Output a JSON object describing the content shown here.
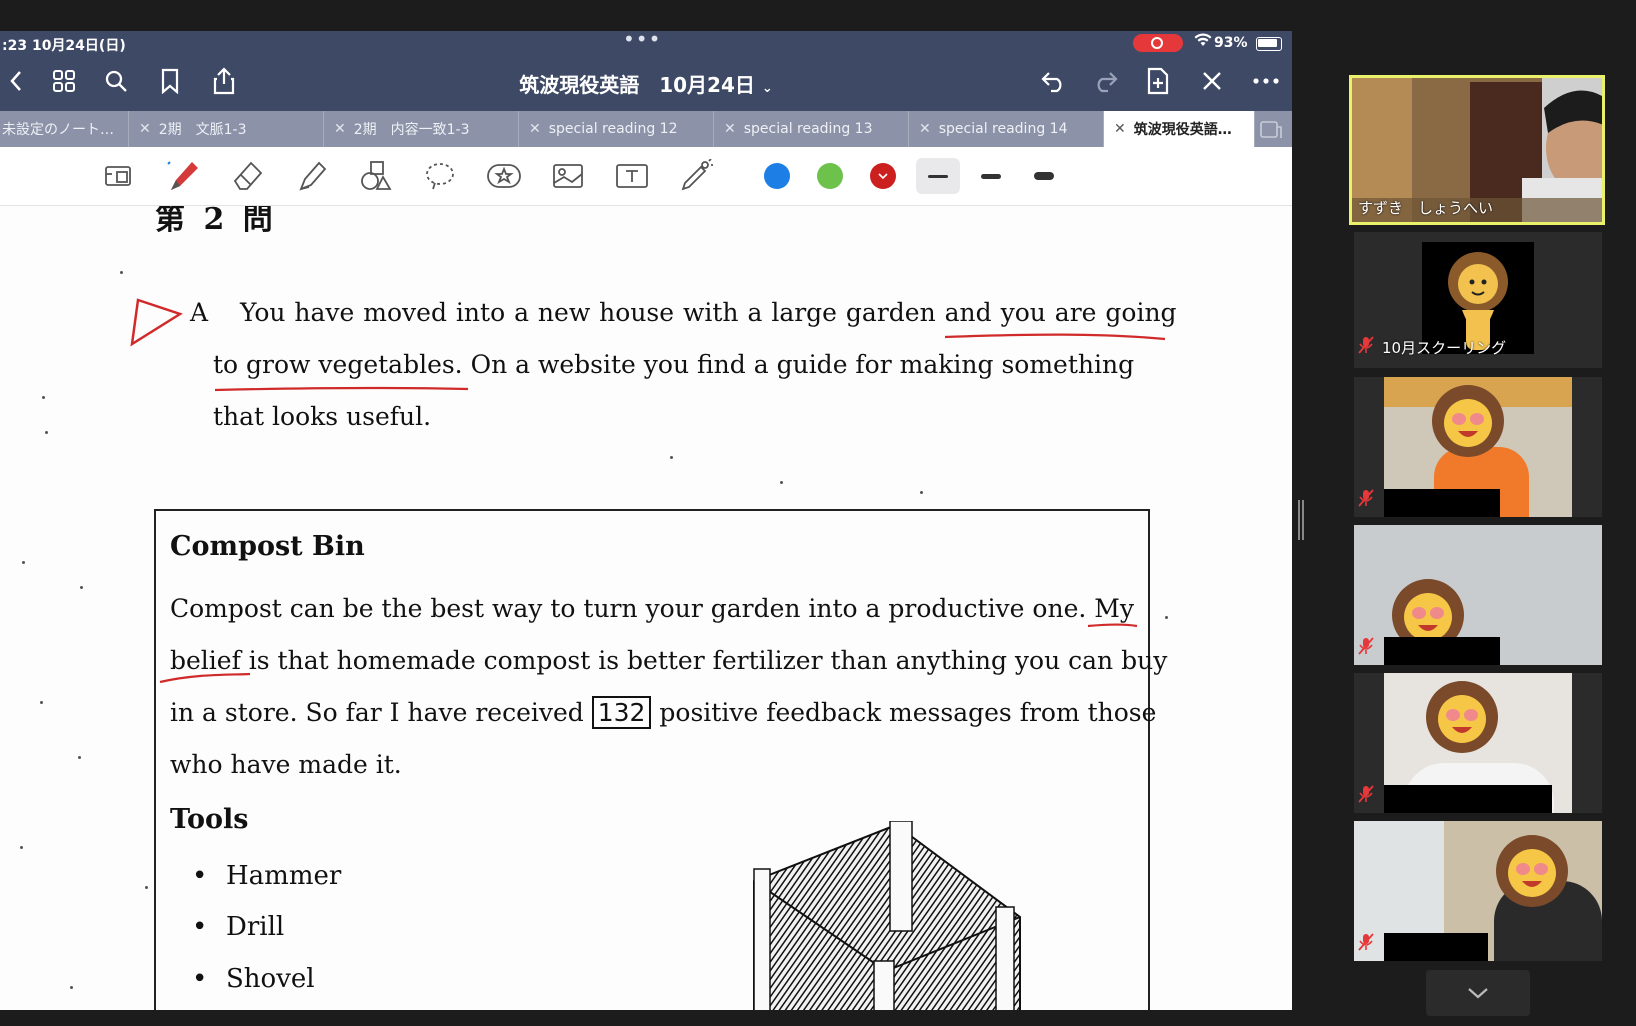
{
  "status_bar": {
    "time": ":23  10月24日(日)",
    "dots": "•••",
    "battery_percent": "93%"
  },
  "nav": {
    "title": "筑波現役英語　10月24日",
    "icons": [
      "back-icon",
      "grid-icon",
      "search-icon",
      "bookmark-icon",
      "share-icon",
      "undo-icon",
      "redo-icon",
      "add-page-icon",
      "close-icon",
      "more-icon"
    ]
  },
  "tabs": [
    {
      "label": "未設定のノート…",
      "active": false
    },
    {
      "label": "2期　文脈1-3",
      "active": false
    },
    {
      "label": "2期　内容一致1-3",
      "active": false
    },
    {
      "label": "special reading 12",
      "active": false
    },
    {
      "label": "special reading 13",
      "active": false
    },
    {
      "label": "special reading 14",
      "active": false
    },
    {
      "label": "筑波現役英語…",
      "active": true
    }
  ],
  "toolbar": {
    "colors": [
      "#1d7fe6",
      "#6cc24a",
      "#cc1f1f"
    ],
    "selected_color": "#cc1f1f",
    "selected_thickness": 0
  },
  "document": {
    "question_header": "第 2 問",
    "section_letter": "A",
    "intro_lines": [
      "You have moved into a new house with a large garden and you are going",
      "to grow vegetables.  On a website you find a guide for making something",
      "that looks useful."
    ],
    "box_title": "Compost Bin",
    "box_lines_1": "Compost can be the best way to turn your garden into a productive one.  My",
    "box_lines_2": "belief is that homemade compost is better fertilizer than anything you can buy",
    "box_line_3_pre": "in a store.  So far I have received ",
    "box_line_3_num": "132",
    "box_line_3_post": " positive feedback messages from those",
    "box_lines_4": "who have made it.",
    "tools_title": "Tools",
    "tools": [
      "Hammer",
      "Drill",
      "Shovel"
    ]
  },
  "zoom": {
    "participants": [
      {
        "name": "すずき　しょうへい",
        "active_speaker": true,
        "muted": false
      },
      {
        "name": "10月スクーリング",
        "active_speaker": false,
        "muted": true
      },
      {
        "name": "",
        "active_speaker": false,
        "muted": true
      },
      {
        "name": "",
        "active_speaker": false,
        "muted": true
      },
      {
        "name": "",
        "active_speaker": false,
        "muted": true
      },
      {
        "name": "",
        "active_speaker": false,
        "muted": true
      }
    ]
  }
}
